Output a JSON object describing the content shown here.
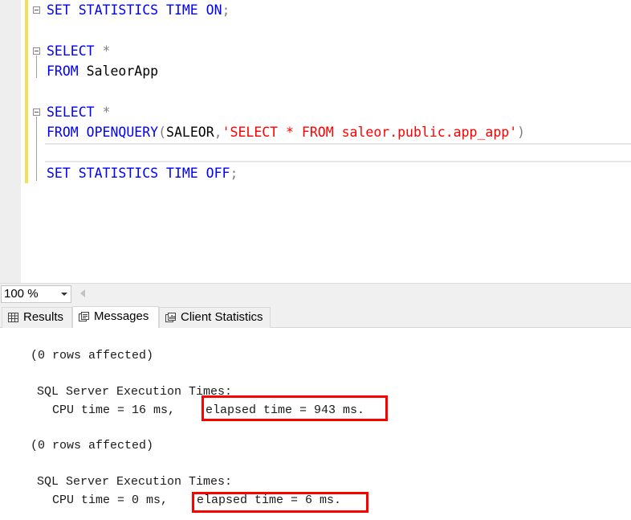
{
  "editor": {
    "line1": {
      "kw": "SET STATISTICS TIME ON",
      "punct": ";"
    },
    "line3": {
      "kw": "SELECT",
      "op": " *"
    },
    "line4": {
      "kw": "FROM",
      "table": " SaleorApp"
    },
    "line6": {
      "kw": "SELECT",
      "op": " *"
    },
    "line7": {
      "kw1": "FROM",
      "kw2": " OPENQUERY",
      "open": "(",
      "server": "SALEOR",
      "comma": ",",
      "query": "'SELECT * FROM saleor.public.app_app'",
      "close": ")"
    },
    "line9": {
      "kw": "SET STATISTICS TIME OFF",
      "punct": ";"
    }
  },
  "zoom": {
    "value": "100 %"
  },
  "tabs": [
    {
      "label": "Results",
      "icon": "grid-icon"
    },
    {
      "label": "Messages",
      "icon": "messages-icon",
      "active": true
    },
    {
      "label": "Client Statistics",
      "icon": "statistics-icon"
    }
  ],
  "messages": {
    "block1": {
      "rows": "(0 rows affected)",
      "header": "SQL Server Execution Times:",
      "cpu": "CPU time = 16 ms,",
      "elapsed": "elapsed time = 943 ms."
    },
    "block2": {
      "rows": "(0 rows affected)",
      "header": "SQL Server Execution Times:",
      "cpu": "CPU time = 0 ms,",
      "elapsed": "elapsed time = 6 ms."
    }
  },
  "colors": {
    "keyword": "#0000ff",
    "string": "#ff0000",
    "operator": "#808080",
    "highlight_box": "#ff0000",
    "change_bar": "#efe15a"
  }
}
